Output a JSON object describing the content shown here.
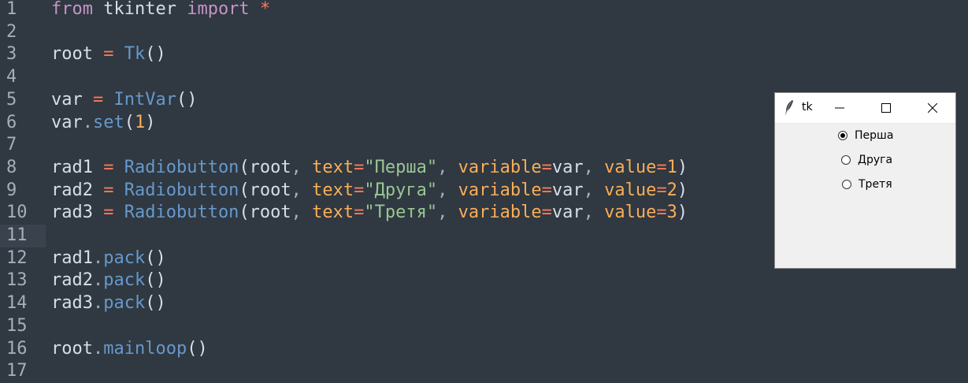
{
  "editor": {
    "lines": [
      {
        "number": "1",
        "tokens": [
          [
            "kw",
            "from"
          ],
          [
            "plain",
            " tkinter "
          ],
          [
            "kw",
            "import"
          ],
          [
            "plain",
            " "
          ],
          [
            "op",
            "*"
          ]
        ]
      },
      {
        "number": "2",
        "tokens": []
      },
      {
        "number": "3",
        "tokens": [
          [
            "plain",
            "root "
          ],
          [
            "op",
            "="
          ],
          [
            "plain",
            " "
          ],
          [
            "fn",
            "Tk"
          ],
          [
            "plain",
            "()"
          ]
        ]
      },
      {
        "number": "4",
        "tokens": []
      },
      {
        "number": "5",
        "tokens": [
          [
            "plain",
            "var "
          ],
          [
            "op",
            "="
          ],
          [
            "plain",
            " "
          ],
          [
            "fn",
            "IntVar"
          ],
          [
            "plain",
            "()"
          ]
        ]
      },
      {
        "number": "6",
        "tokens": [
          [
            "plain",
            "var"
          ],
          [
            "punc",
            "."
          ],
          [
            "fn",
            "set"
          ],
          [
            "plain",
            "("
          ],
          [
            "num",
            "1"
          ],
          [
            "plain",
            ")"
          ]
        ]
      },
      {
        "number": "7",
        "tokens": []
      },
      {
        "number": "8",
        "tokens": [
          [
            "plain",
            "rad1 "
          ],
          [
            "op",
            "="
          ],
          [
            "plain",
            " "
          ],
          [
            "fn",
            "Radiobutton"
          ],
          [
            "plain",
            "(root"
          ],
          [
            "punc",
            ", "
          ],
          [
            "param",
            "text"
          ],
          [
            "op",
            "="
          ],
          [
            "str",
            "\"Перша\""
          ],
          [
            "punc",
            ", "
          ],
          [
            "param",
            "variable"
          ],
          [
            "op",
            "="
          ],
          [
            "plain",
            "var"
          ],
          [
            "punc",
            ", "
          ],
          [
            "param",
            "value"
          ],
          [
            "op",
            "="
          ],
          [
            "num",
            "1"
          ],
          [
            "plain",
            ")"
          ]
        ]
      },
      {
        "number": "9",
        "tokens": [
          [
            "plain",
            "rad2 "
          ],
          [
            "op",
            "="
          ],
          [
            "plain",
            " "
          ],
          [
            "fn",
            "Radiobutton"
          ],
          [
            "plain",
            "(root"
          ],
          [
            "punc",
            ", "
          ],
          [
            "param",
            "text"
          ],
          [
            "op",
            "="
          ],
          [
            "str",
            "\"Друга\""
          ],
          [
            "punc",
            ", "
          ],
          [
            "param",
            "variable"
          ],
          [
            "op",
            "="
          ],
          [
            "plain",
            "var"
          ],
          [
            "punc",
            ", "
          ],
          [
            "param",
            "value"
          ],
          [
            "op",
            "="
          ],
          [
            "num",
            "2"
          ],
          [
            "plain",
            ")"
          ]
        ]
      },
      {
        "number": "10",
        "tokens": [
          [
            "plain",
            "rad3 "
          ],
          [
            "op",
            "="
          ],
          [
            "plain",
            " "
          ],
          [
            "fn",
            "Radiobutton"
          ],
          [
            "plain",
            "(root"
          ],
          [
            "punc",
            ", "
          ],
          [
            "param",
            "text"
          ],
          [
            "op",
            "="
          ],
          [
            "str",
            "\"Третя\""
          ],
          [
            "punc",
            ", "
          ],
          [
            "param",
            "variable"
          ],
          [
            "op",
            "="
          ],
          [
            "plain",
            "var"
          ],
          [
            "punc",
            ", "
          ],
          [
            "param",
            "value"
          ],
          [
            "op",
            "="
          ],
          [
            "num",
            "3"
          ],
          [
            "plain",
            ")"
          ]
        ]
      },
      {
        "number": "11",
        "tokens": [],
        "current": true
      },
      {
        "number": "12",
        "tokens": [
          [
            "plain",
            "rad1"
          ],
          [
            "punc",
            "."
          ],
          [
            "fn",
            "pack"
          ],
          [
            "plain",
            "()"
          ]
        ]
      },
      {
        "number": "13",
        "tokens": [
          [
            "plain",
            "rad2"
          ],
          [
            "punc",
            "."
          ],
          [
            "fn",
            "pack"
          ],
          [
            "plain",
            "()"
          ]
        ]
      },
      {
        "number": "14",
        "tokens": [
          [
            "plain",
            "rad3"
          ],
          [
            "punc",
            "."
          ],
          [
            "fn",
            "pack"
          ],
          [
            "plain",
            "()"
          ]
        ]
      },
      {
        "number": "15",
        "tokens": []
      },
      {
        "number": "16",
        "tokens": [
          [
            "plain",
            "root"
          ],
          [
            "punc",
            "."
          ],
          [
            "fn",
            "mainloop"
          ],
          [
            "plain",
            "()"
          ]
        ]
      },
      {
        "number": "17",
        "tokens": []
      }
    ]
  },
  "tk_window": {
    "title": "tk",
    "icon": "feather-icon",
    "controls": {
      "minimize": "minimize-icon",
      "maximize": "maximize-icon",
      "close": "close-icon"
    },
    "radios": [
      {
        "label": "Перша",
        "checked": true
      },
      {
        "label": "Друга",
        "checked": false
      },
      {
        "label": "Третя",
        "checked": false
      }
    ]
  },
  "colors": {
    "background": "#303841",
    "keyword": "#c594c5",
    "operator": "#f97b58",
    "function": "#6699cc",
    "number": "#f9ae58",
    "string": "#99c794",
    "plain": "#d8dee9",
    "gutter": "#a7adba"
  }
}
